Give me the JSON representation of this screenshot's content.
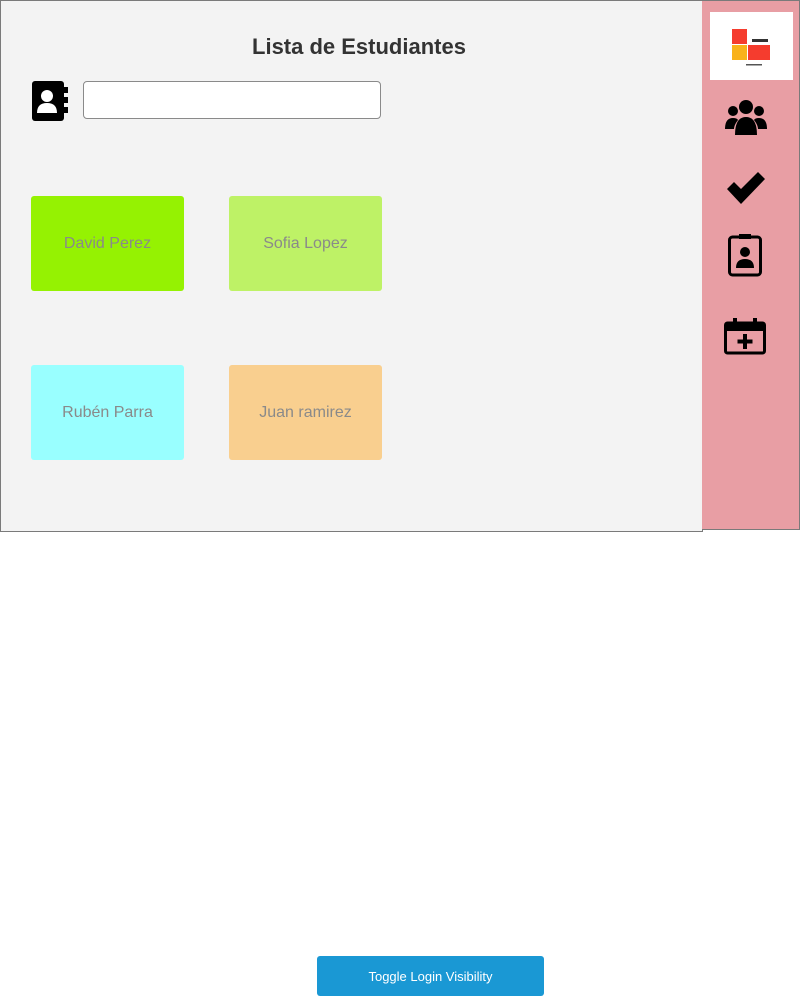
{
  "header": {
    "title": "Lista de Estudiantes"
  },
  "search": {
    "value": "",
    "placeholder": ""
  },
  "students": [
    {
      "name": "David Perez",
      "color": "#95f202"
    },
    {
      "name": "Sofia Lopez",
      "color": "#bef266"
    },
    {
      "name": "Rubén Parra",
      "color": "#99ffff"
    },
    {
      "name": "Juan ramirez",
      "color": "#f9cf8f"
    }
  ],
  "sidebar": {
    "background": "#e89ea4",
    "items": [
      {
        "icon": "users-icon"
      },
      {
        "icon": "checkmark-icon"
      },
      {
        "icon": "id-badge-icon"
      },
      {
        "icon": "calendar-add-icon"
      }
    ]
  },
  "footer": {
    "toggle_label": "Toggle Login Visibility",
    "button_color": "#1a98d4"
  }
}
